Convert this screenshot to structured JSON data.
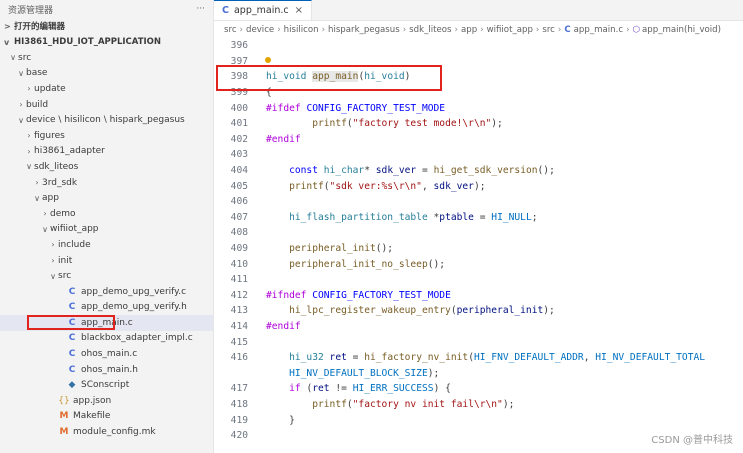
{
  "sidebar": {
    "title": "资源管理器",
    "more_label": "···",
    "open_editors": "打开的编辑器",
    "project": "HI3861_HDU_IOT_APPLICATION",
    "tree": [
      {
        "label": "src",
        "depth": 0,
        "chev": "v",
        "icon": ""
      },
      {
        "label": "base",
        "depth": 1,
        "chev": "v",
        "icon": ""
      },
      {
        "label": "update",
        "depth": 2,
        "chev": ">",
        "icon": ""
      },
      {
        "label": "build",
        "depth": 1,
        "chev": ">",
        "icon": ""
      },
      {
        "label": "device \\ hisilicon \\ hispark_pegasus",
        "depth": 1,
        "chev": "v",
        "icon": ""
      },
      {
        "label": "figures",
        "depth": 2,
        "chev": ">",
        "icon": ""
      },
      {
        "label": "hi3861_adapter",
        "depth": 2,
        "chev": ">",
        "icon": ""
      },
      {
        "label": "sdk_liteos",
        "depth": 2,
        "chev": "v",
        "icon": ""
      },
      {
        "label": "3rd_sdk",
        "depth": 3,
        "chev": ">",
        "icon": ""
      },
      {
        "label": "app",
        "depth": 3,
        "chev": "v",
        "icon": ""
      },
      {
        "label": "demo",
        "depth": 4,
        "chev": ">",
        "icon": ""
      },
      {
        "label": "wifiiot_app",
        "depth": 4,
        "chev": "v",
        "icon": ""
      },
      {
        "label": "include",
        "depth": 5,
        "chev": ">",
        "icon": ""
      },
      {
        "label": "init",
        "depth": 5,
        "chev": ">",
        "icon": ""
      },
      {
        "label": "src",
        "depth": 5,
        "chev": "v",
        "icon": ""
      },
      {
        "label": "app_demo_upg_verify.c",
        "depth": 6,
        "chev": "",
        "icon": "C"
      },
      {
        "label": "app_demo_upg_verify.h",
        "depth": 6,
        "chev": "",
        "icon": "C"
      },
      {
        "label": "app_main.c",
        "depth": 6,
        "chev": "",
        "icon": "C",
        "selected": true
      },
      {
        "label": "blackbox_adapter_impl.c",
        "depth": 6,
        "chev": "",
        "icon": "C"
      },
      {
        "label": "ohos_main.c",
        "depth": 6,
        "chev": "",
        "icon": "C"
      },
      {
        "label": "ohos_main.h",
        "depth": 6,
        "chev": "",
        "icon": "C"
      },
      {
        "label": "SConscript",
        "depth": 6,
        "chev": "",
        "icon": "PY"
      },
      {
        "label": "app.json",
        "depth": 5,
        "chev": "",
        "icon": "{}"
      },
      {
        "label": "Makefile",
        "depth": 5,
        "chev": "",
        "icon": "M"
      },
      {
        "label": "module_config.mk",
        "depth": 5,
        "chev": "",
        "icon": "M"
      }
    ]
  },
  "editor": {
    "tab": {
      "icon": "C",
      "label": "app_main.c",
      "close": "×"
    },
    "breadcrumb": [
      "src",
      "device",
      "hisilicon",
      "hispark_pegasus",
      "sdk_liteos",
      "app",
      "wifiiot_app",
      "src",
      "app_main.c",
      "app_main(hi_void)"
    ],
    "lines": [
      {
        "n": "396",
        "html": ""
      },
      {
        "n": "397",
        "html": ""
      },
      {
        "n": "398",
        "html": "<span class='ty'>hi_void</span> <span class='fn hl-fn'>app_main</span><span class='c'>(</span><span class='ty'>hi_void</span><span class='c'>)</span>"
      },
      {
        "n": "399",
        "html": "<span class='c'>{</span>"
      },
      {
        "n": "400",
        "html": "<span class='pp'>#ifdef</span> <span class='k'>CONFIG_FACTORY_TEST_MODE</span>"
      },
      {
        "n": "401",
        "html": "        <span class='fn'>printf</span><span class='c'>(</span><span class='s'>\"factory test mode!\\r\\n\"</span><span class='c'>);</span>"
      },
      {
        "n": "402",
        "html": "<span class='pp'>#endif</span>"
      },
      {
        "n": "403",
        "html": ""
      },
      {
        "n": "404",
        "html": "    <span class='k'>const</span> <span class='ty'>hi_char</span><span class='c'>*</span> <span class='text'>sdk_ver</span> <span class='c'>=</span> <span class='fn'>hi_get_sdk_version</span><span class='c'>();</span>"
      },
      {
        "n": "405",
        "html": "    <span class='fn'>printf</span><span class='c'>(</span><span class='s'>\"sdk ver:%s\\r\\n\"</span><span class='c'>,</span> <span class='text'>sdk_ver</span><span class='c'>);</span>"
      },
      {
        "n": "406",
        "html": ""
      },
      {
        "n": "407",
        "html": "    <span class='ty'>hi_flash_partition_table</span> <span class='c'>*</span><span class='text'>ptable</span> <span class='c'>=</span> <span class='m'>HI_NULL</span><span class='c'>;</span>"
      },
      {
        "n": "408",
        "html": ""
      },
      {
        "n": "409",
        "html": "    <span class='fn'>peripheral_init</span><span class='c'>();</span>"
      },
      {
        "n": "410",
        "html": "    <span class='fn'>peripheral_init_no_sleep</span><span class='c'>();</span>"
      },
      {
        "n": "411",
        "html": ""
      },
      {
        "n": "412",
        "html": "<span class='pp'>#ifndef</span> <span class='k'>CONFIG_FACTORY_TEST_MODE</span>"
      },
      {
        "n": "413",
        "html": "    <span class='fn'>hi_lpc_register_wakeup_entry</span><span class='c'>(</span><span class='text'>peripheral_init</span><span class='c'>);</span>"
      },
      {
        "n": "414",
        "html": "<span class='pp'>#endif</span>"
      },
      {
        "n": "415",
        "html": ""
      },
      {
        "n": "416",
        "html": "    <span class='ty'>hi_u32</span> <span class='text'>ret</span> <span class='c'>=</span> <span class='fn'>hi_factory_nv_init</span><span class='c'>(</span><span class='m'>HI_FNV_DEFAULT_ADDR</span><span class='c'>,</span> <span class='m'>HI_NV_DEFAULT_TOTAL</span>"
      },
      {
        "n": "",
        "html": "    <span class='m'>HI_NV_DEFAULT_BLOCK_SIZE</span><span class='c'>);</span>"
      },
      {
        "n": "417",
        "html": "    <span class='pp'>if</span> <span class='c'>(</span><span class='text'>ret</span> <span class='c'>!=</span> <span class='m'>HI_ERR_SUCCESS</span><span class='c'>) {</span>"
      },
      {
        "n": "418",
        "html": "        <span class='fn'>printf</span><span class='c'>(</span><span class='s'>\"factory nv init fail\\r\\n\"</span><span class='c'>);</span>"
      },
      {
        "n": "419",
        "html": "    <span class='c'>}</span>"
      },
      {
        "n": "420",
        "html": ""
      }
    ]
  },
  "watermark": "CSDN @普中科技"
}
